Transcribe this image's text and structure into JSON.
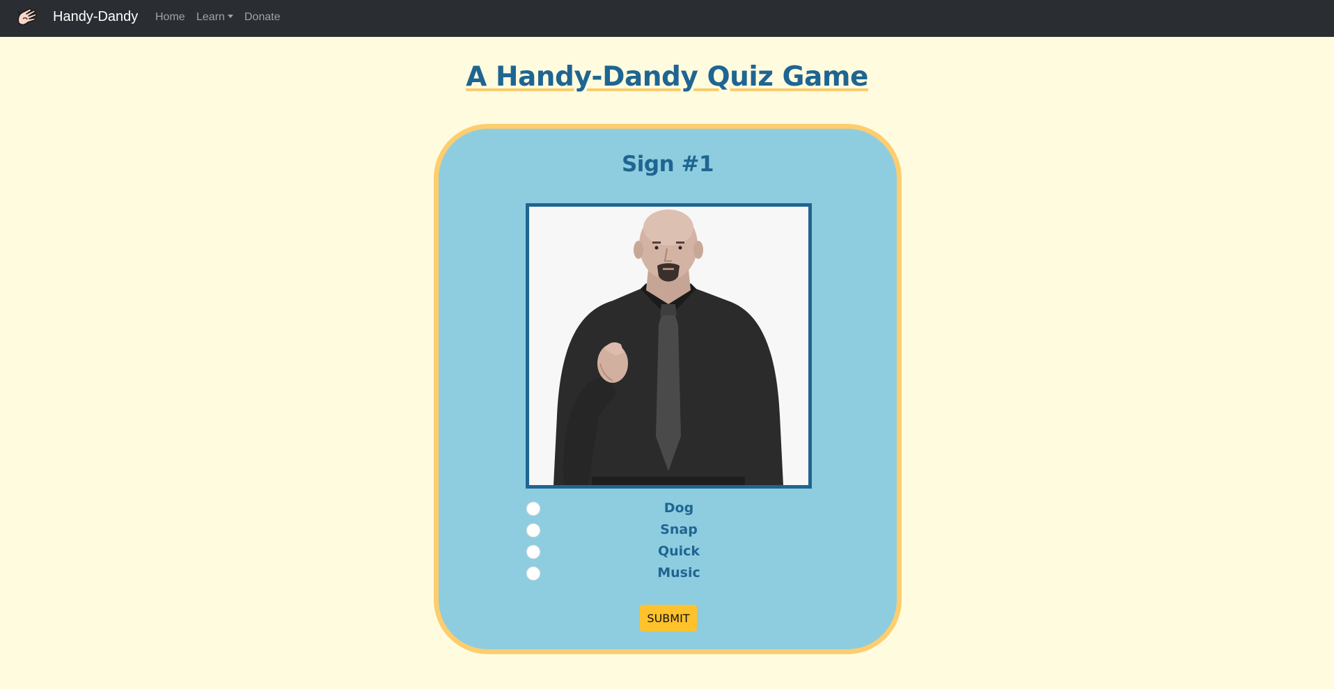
{
  "navbar": {
    "brand": "Handy-Dandy",
    "logo_icon": "hand-sign-icon",
    "links": {
      "home": "Home",
      "learn": "Learn",
      "donate": "Donate"
    }
  },
  "page": {
    "title": "A Handy-Dandy Quiz Game"
  },
  "quiz": {
    "sign_title": "Sign #1",
    "options": [
      "Dog",
      "Snap",
      "Quick",
      "Music"
    ],
    "submit_label": "SUBMIT"
  },
  "colors": {
    "background": "#fffbdf",
    "navbar": "#2a2e33",
    "card": "#8ecddf",
    "card_border": "#fdcd6e",
    "text_blue": "#1f6591",
    "submit": "#fec22c"
  }
}
